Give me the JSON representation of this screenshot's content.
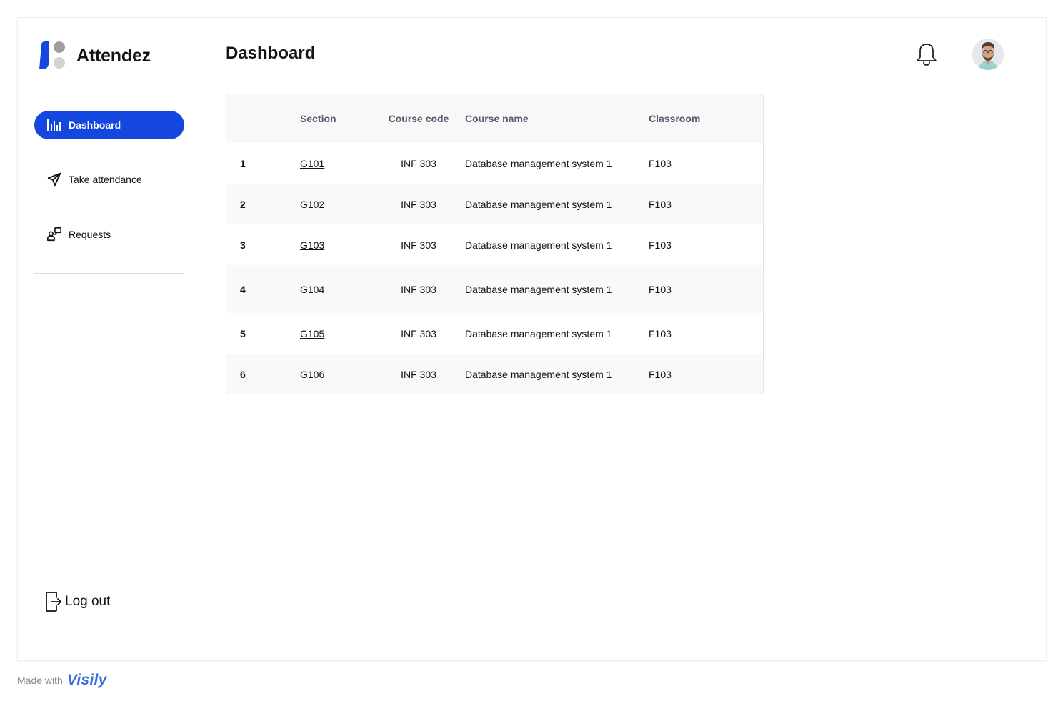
{
  "app": {
    "name": "Attendez"
  },
  "sidebar": {
    "items": [
      {
        "label": "Dashboard",
        "icon": "bar-chart-icon",
        "active": true
      },
      {
        "label": "Take attendance",
        "icon": "paper-plane-icon",
        "active": false
      },
      {
        "label": "Requests",
        "icon": "requests-icon",
        "active": false
      }
    ],
    "logout_label": "Log out"
  },
  "header": {
    "title": "Dashboard"
  },
  "table": {
    "columns": [
      "",
      "Section",
      "Course code",
      "Course name",
      "Classroom"
    ],
    "rows": [
      {
        "index": "1",
        "section": "G101",
        "course_code": "INF 303",
        "course_name": "Database management system 1",
        "classroom": "F103"
      },
      {
        "index": "2",
        "section": "G102",
        "course_code": "INF 303",
        "course_name": "Database management system 1",
        "classroom": "F103"
      },
      {
        "index": "3",
        "section": "G103",
        "course_code": "INF 303",
        "course_name": "Database management system 1",
        "classroom": "F103"
      },
      {
        "index": "4",
        "section": "G104",
        "course_code": "INF 303",
        "course_name": "Database management system 1",
        "classroom": "F103"
      },
      {
        "index": "5",
        "section": "G105",
        "course_code": "INF 303",
        "course_name": "Database management system 1",
        "classroom": "F103"
      },
      {
        "index": "6",
        "section": "G106",
        "course_code": "INF 303",
        "course_name": "Database management system 1",
        "classroom": "F103"
      }
    ]
  },
  "footer": {
    "made_with": "Made with",
    "brand": "Visily"
  },
  "colors": {
    "accent": "#1447e0",
    "logo_blue": "#1447e0",
    "logo_gray": "#9e9e9e",
    "logo_light": "#d6d3cd"
  }
}
